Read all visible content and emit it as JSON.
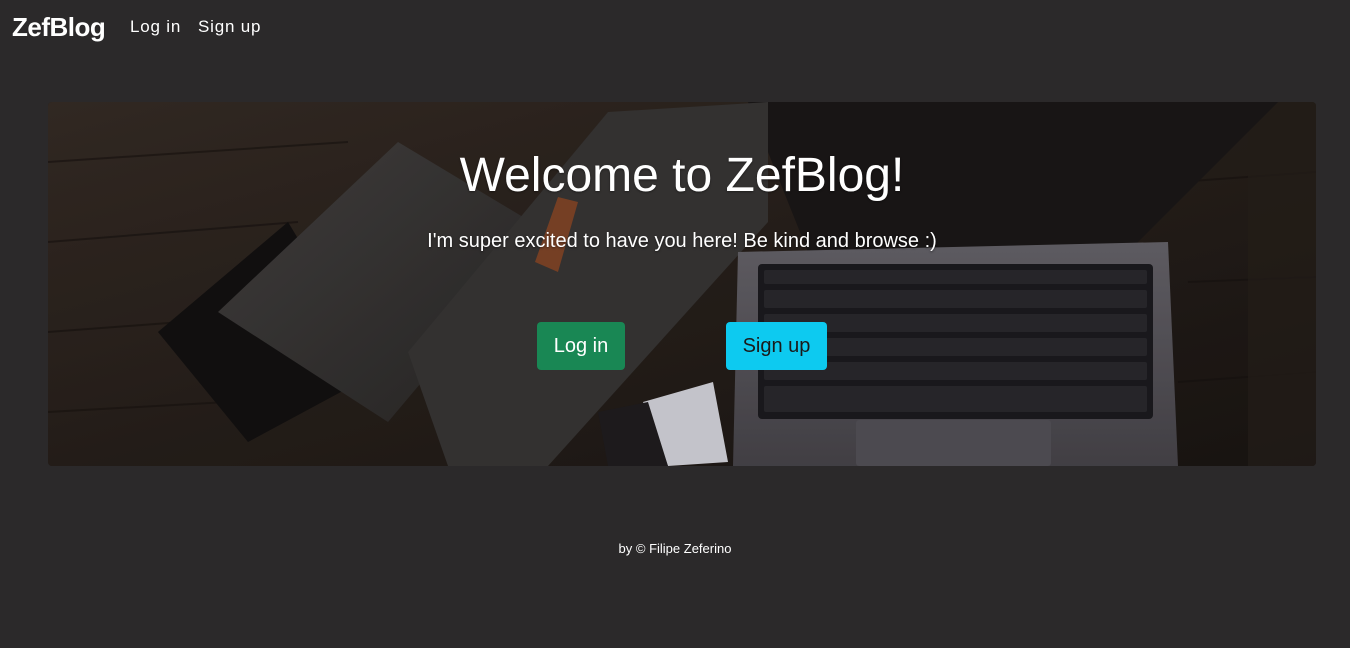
{
  "navbar": {
    "brand": "ZefBlog",
    "links": [
      {
        "label": "Log in"
      },
      {
        "label": "Sign up"
      }
    ]
  },
  "hero": {
    "title": "Welcome to ZefBlog!",
    "subtitle": "I'm super excited to have you here! Be kind and browse :)",
    "buttons": {
      "login_label": "Log in",
      "signup_label": "Sign up"
    },
    "background_image": "desk-with-laptop-and-felt-sleeve"
  },
  "footer": {
    "text": "by © Filipe Zeferino"
  },
  "colors": {
    "page_background": "#2b292a",
    "login_button": "#198754",
    "signup_button": "#0dcaf0",
    "text": "#ffffff"
  }
}
